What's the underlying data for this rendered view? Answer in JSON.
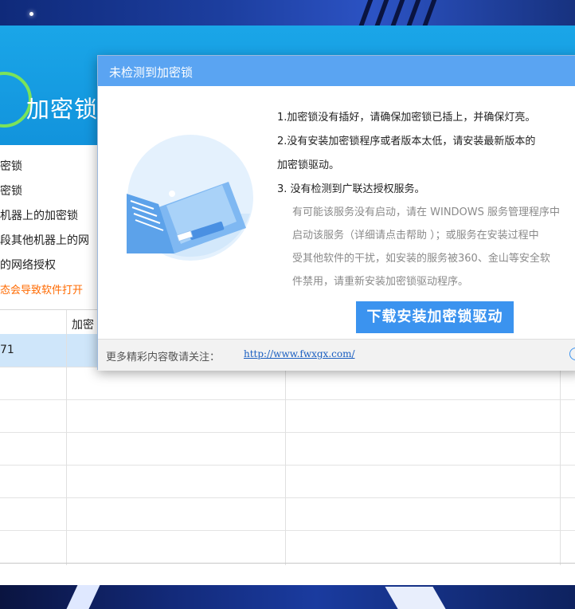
{
  "app": {
    "title": "加密锁",
    "menu_items": [
      "密锁",
      "密锁",
      "机器上的加密锁",
      "段其他机器上的网",
      "的网络授权"
    ],
    "warning": "态会导致软件打开",
    "grid": {
      "header_cell": "加密",
      "selected_row_cell": "71"
    }
  },
  "dialog": {
    "title": "未检测到加密锁",
    "lines": [
      "1.加密锁没有插好，请确保加密锁已插上，并确保灯亮。",
      "2.没有安装加密锁程序或者版本太低，请安装最新版本的",
      "加密锁驱动。",
      "3. 没有检测到广联达授权服务。"
    ],
    "sub_lines": [
      "有可能该服务没有启动，请在 WINDOWS 服务管理程序中",
      "启动该服务（详细请点击帮助 ）；或服务在安装过程中",
      "受其他软件的干扰，如安装的服务被360、金山等安全软",
      "件禁用，请重新安装加密锁驱动程序。"
    ],
    "download_button": "下载安装加密锁驱动",
    "footer_text": "更多精彩内容敬请关注：",
    "footer_link": "http://www.fwxgx.com/"
  },
  "colors": {
    "dialog_titlebar": "#5aa4f2",
    "button": "#3b93ef",
    "app_header": "#1aa6e8",
    "warning": "#ff6a00"
  }
}
